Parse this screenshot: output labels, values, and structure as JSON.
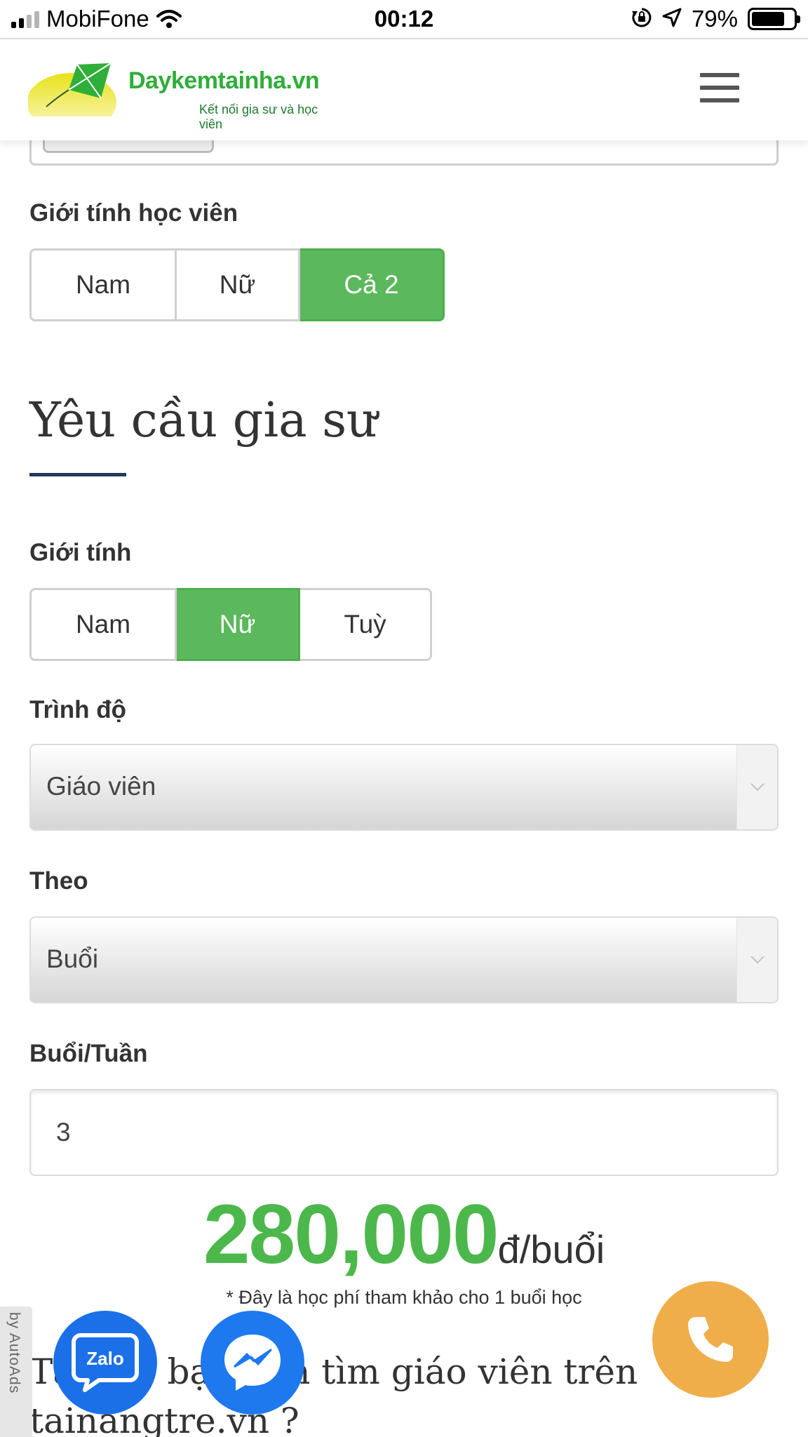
{
  "status_bar": {
    "carrier": "MobiFone",
    "time": "00:12",
    "battery_percent": "79%",
    "battery_level": 0.79
  },
  "header": {
    "logo_name": "Daykemtainha.vn",
    "logo_tagline": "Kết nối gia sư và học viên",
    "menu_icon": "hamburger-menu-icon"
  },
  "student_gender": {
    "label": "Giới tính học viên",
    "options": [
      "Nam",
      "Nữ",
      "Cả 2"
    ],
    "selected": "Cả 2"
  },
  "tutor_section": {
    "title": "Yêu cầu gia sư",
    "gender": {
      "label": "Giới tính",
      "options": [
        "Nam",
        "Nữ",
        "Tuỳ"
      ],
      "selected": "Nữ"
    },
    "level": {
      "label": "Trình độ",
      "value": "Giáo viên"
    },
    "by": {
      "label": "Theo",
      "value": "Buổi"
    },
    "sessions_per_week": {
      "label": "Buổi/Tuần",
      "value": "3"
    }
  },
  "price": {
    "amount": "280,000",
    "unit": "đ/buổi",
    "note": "* Đây là học phí tham khảo cho 1 buổi học"
  },
  "bottom": {
    "question_line1": "Tại sao bạn nên tìm giáo viên trên",
    "question_line2": "tainangtre.vn ?"
  },
  "floating": {
    "autoads_label": "by AutoAds",
    "zalo_label": "Zalo",
    "zalo_icon": "zalo-icon",
    "messenger_icon": "messenger-icon",
    "call_icon": "phone-icon"
  },
  "colors": {
    "active_green": "#5cb85c",
    "price_green": "#4cb84c",
    "call_orange": "#efae4a",
    "zalo_blue": "#1b70e8",
    "rule_navy": "#1f3a5a"
  }
}
